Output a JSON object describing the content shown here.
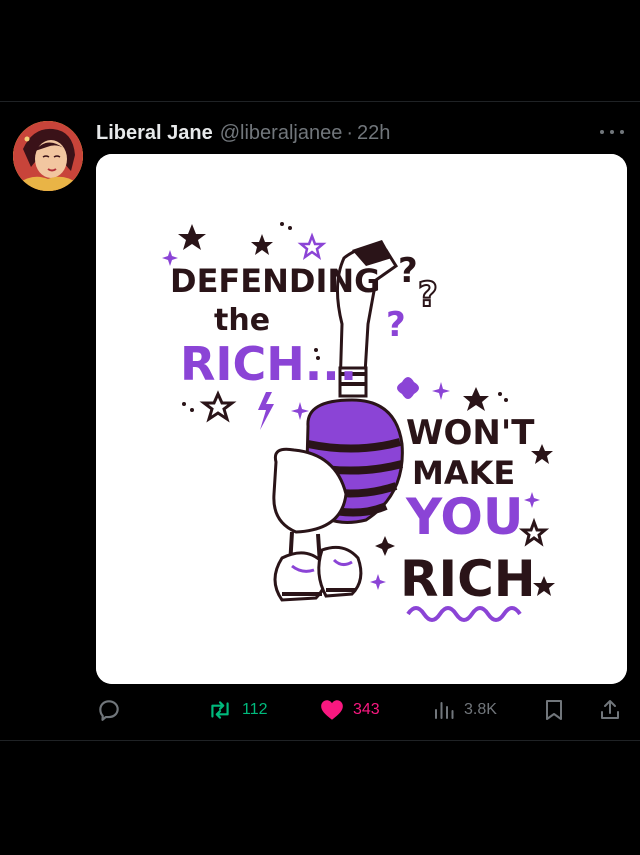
{
  "post": {
    "author_name": "Liberal Jane",
    "author_handle": "@liberaljanee",
    "separator": "·",
    "time_ago": "22h",
    "avatar_icon": "avatar-illustration",
    "more_icon": "more-dots-icon"
  },
  "image": {
    "text_lines": [
      "DEFENDING",
      "the",
      "RICH...",
      "WON'T",
      "MAKE",
      "YOU",
      "RICH"
    ],
    "subject": "goose-in-striped-sweater-and-sneakers",
    "colors": {
      "ink": "#2a1418",
      "purple": "#8b44d6",
      "paper": "#ffffff"
    }
  },
  "actions": {
    "reply": {
      "icon": "reply-icon",
      "count": ""
    },
    "repost": {
      "icon": "repost-icon",
      "count": "112",
      "color": "#00ba7c"
    },
    "like": {
      "icon": "heart-icon",
      "count": "343",
      "color": "#f91880"
    },
    "views": {
      "icon": "views-icon",
      "count": "3.8K"
    },
    "bookmark": {
      "icon": "bookmark-icon"
    },
    "share": {
      "icon": "share-icon"
    }
  }
}
